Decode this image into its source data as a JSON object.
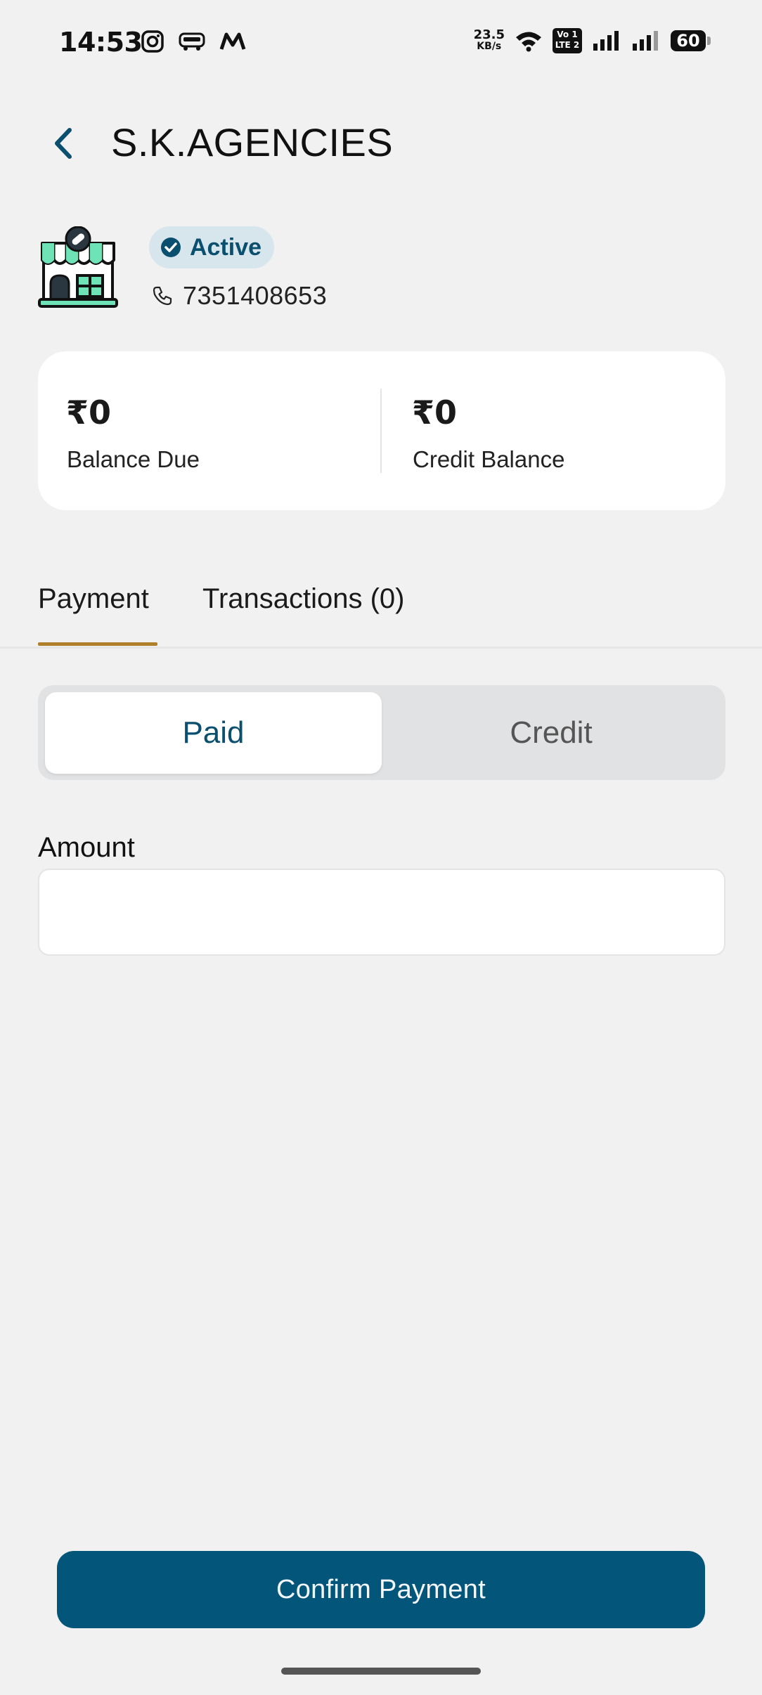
{
  "status_bar": {
    "time": "14:53",
    "app_icons": [
      "instagram-icon",
      "redbus-icon",
      "myntra-icon"
    ],
    "net_speed_value": "23.5",
    "net_speed_unit": "KB/s",
    "volte_top": "Vo 1",
    "volte_bottom": "LTE 2",
    "battery": "60"
  },
  "header": {
    "title": "S.K.AGENCIES"
  },
  "shop": {
    "status": "Active",
    "phone": "7351408653"
  },
  "balances": {
    "due_amount": "₹0",
    "due_label": "Balance Due",
    "credit_amount": "₹0",
    "credit_label": "Credit Balance"
  },
  "tabs": [
    {
      "label": "Payment",
      "active": true
    },
    {
      "label": "Transactions (0)",
      "active": false
    }
  ],
  "payment_type": {
    "options": [
      "Paid",
      "Credit"
    ],
    "selected": "Paid"
  },
  "amount_field": {
    "label": "Amount",
    "value": "",
    "placeholder": ""
  },
  "confirm_label": "Confirm Payment",
  "colors": {
    "primary": "#03567a",
    "accent_tab": "#b07f2a",
    "background": "#f1f1f1",
    "badge_bg": "#d7e5ec"
  }
}
